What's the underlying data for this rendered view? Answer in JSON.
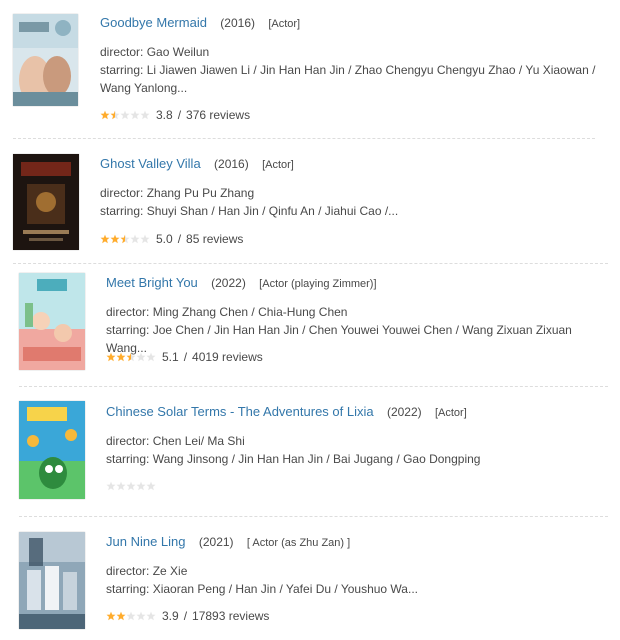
{
  "labels": {
    "director": "director:",
    "starring": "starring:",
    "rating_sep": "/"
  },
  "entries": [
    {
      "title": "Goodbye Mermaid",
      "year": "(2016)",
      "role": "[Actor]",
      "director": "Gao Weilun",
      "starring": "Li Jiawen Jiawen Li / Jin Han Han Jin / Zhao Chengyu Chengyu Zhao / Yu Xiaowan / Wang Yanlong...",
      "score": "3.8",
      "reviews": "376 reviews",
      "stars": 1.5
    },
    {
      "title": "Ghost Valley Villa",
      "year": "(2016)",
      "role": "[Actor]",
      "director": "Zhang Pu Pu Zhang",
      "starring": "Shuyi Shan / Han Jin / Qinfu An / Jiahui Cao /...",
      "score": "5.0",
      "reviews": "85 reviews",
      "stars": 2.5
    },
    {
      "title": "Meet Bright You",
      "year": "(2022)",
      "role": "[Actor (playing Zimmer)]",
      "director": "Ming Zhang Chen / Chia-Hung Chen",
      "starring": "Joe Chen / Jin Han Han Jin / Chen Youwei Youwei Chen / Wang Zixuan Zixuan Wang...",
      "score": "5.1",
      "reviews": "4019 reviews",
      "stars": 2.5
    },
    {
      "title": "Chinese Solar Terms - The Adventures of Lixia",
      "year": "(2022)",
      "role": "[Actor]",
      "director": "Chen Lei/ Ma Shi",
      "starring": "Wang Jinsong / Jin Han Han Jin / Bai Jugang / Gao Dongping",
      "score": "",
      "reviews": "",
      "stars": 0
    },
    {
      "title": "Jun Nine Ling",
      "year": "(2021)",
      "role": "[ Actor (as Zhu Zan) ]",
      "director": "Ze Xie",
      "starring": "Xiaoran Peng / Han Jin / Yafei Du / Youshuo Wa...",
      "score": "3.9",
      "reviews": "17893 reviews",
      "stars": 2
    }
  ],
  "colors": {
    "link": "#3377aa",
    "star": "#ffac2d",
    "star_empty": "#e5e5e5",
    "text": "#494949"
  }
}
